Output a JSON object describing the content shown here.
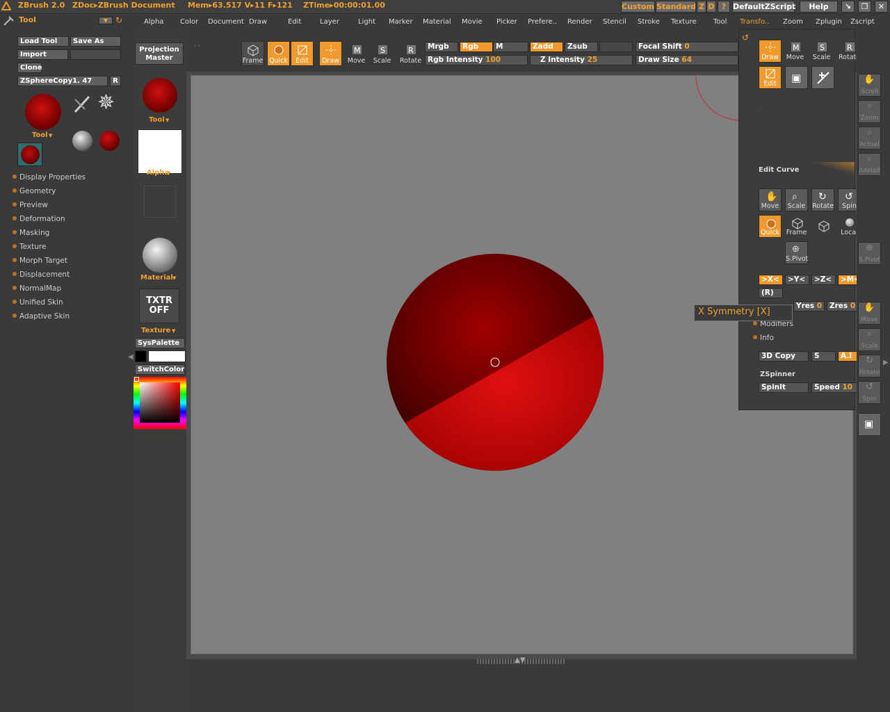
{
  "titlebar": {
    "app": "ZBrush 2.0",
    "doc": "ZDoc▸ZBrush Document",
    "stats": "Mem▸63.517  V▸11  F▸121",
    "ztime": "ZTime▸00:00:01.00",
    "buttons": [
      "Custom",
      "Standard",
      "Z",
      "D",
      "?"
    ],
    "script_button": "DefaultZScript",
    "help_button": "Help"
  },
  "menus": [
    "Alpha",
    "Color",
    "Document",
    "Draw",
    "Edit",
    "Layer",
    "Light",
    "Marker",
    "Material",
    "Movie",
    "Picker",
    "Prefere..",
    "Render",
    "Stencil",
    "Stroke",
    "Texture",
    "Tool",
    "Transfo..",
    "Zoom",
    "Zplugin",
    "Zscript"
  ],
  "tool_palette": {
    "title": "Tool",
    "load_tool": "Load Tool",
    "save_as": "Save As",
    "import": "Import",
    "clone": "Clone",
    "current_tool": "ZSphereCopy1. 47",
    "r_button": "R",
    "tool_label": "Tool",
    "sections": [
      "Display Properties",
      "Geometry",
      "Preview",
      "Deformation",
      "Masking",
      "Texture",
      "Morph Target",
      "Displacement",
      "NormalMap",
      "Unified Skin",
      "Adaptive Skin"
    ]
  },
  "left_shelf": {
    "projection_master": "Projection Master",
    "tool_label": "Tool",
    "alpha_label": "Alpha",
    "material_label": "Material",
    "txtr_off": "TXTR OFF",
    "texture_label": "Texture",
    "syspalette": "SysPalette",
    "switchcolor": "SwitchColor"
  },
  "draw_toolbar": {
    "buttons": [
      {
        "label": "Frame",
        "active": false
      },
      {
        "label": "Quick",
        "active": true
      },
      {
        "label": "Edit",
        "active": true
      },
      {
        "label": "Draw",
        "active": true
      },
      {
        "label": "Move",
        "active": false
      },
      {
        "label": "Scale",
        "active": false
      },
      {
        "label": "Rotate",
        "active": false
      }
    ],
    "mrgb": "Mrgb",
    "rgb": "Rgb",
    "m": "M",
    "zadd": "Zadd",
    "zsub": "Zsub",
    "focal_shift_label": "Focal Shift",
    "focal_shift": "0",
    "rgb_intensity_label": "Rgb Intensity",
    "rgb_intensity": "100",
    "z_intensity_label": "Z Intensity",
    "z_intensity": "25",
    "draw_size_label": "Draw Size",
    "draw_size": "64"
  },
  "transform_panel": {
    "top_buttons": [
      {
        "label": "Draw",
        "active": true
      },
      {
        "label": "Move",
        "active": false
      },
      {
        "label": "Scale",
        "active": false
      },
      {
        "label": "Rotate",
        "active": false
      }
    ],
    "edit_label": "Edit",
    "edit_curve": "Edit Curve",
    "nav_buttons": [
      "Move",
      "Scale",
      "Rotate",
      "Spin"
    ],
    "view_buttons": [
      {
        "label": "Quick",
        "active": true
      },
      {
        "label": "Frame",
        "active": false
      },
      {
        "label": "Local",
        "active": false
      }
    ],
    "spivot": "S.Pivot",
    "sym_buttons": [
      {
        "label": ">X<",
        "active": true
      },
      {
        "label": ">Y<",
        "active": false
      },
      {
        "label": ">Z<",
        "active": false
      },
      {
        "label": ">M<",
        "active": true
      }
    ],
    "r_label": "(R)",
    "yres_label": "Yres",
    "yres": "0",
    "zres_label": "Zres",
    "zres": "0",
    "modifiers": "Modifiers",
    "info": "Info",
    "copy3d": "3D Copy",
    "s_label": "S",
    "ai_label": "A.I",
    "zspinner": "ZSpinner",
    "spinit": "SpinIt",
    "speed_label": "Speed",
    "speed": "10"
  },
  "right_shelf": [
    "Scroll",
    "Zoom",
    "Actual",
    "AAHalf",
    "Move",
    "Scale",
    "Rotate",
    "Spin",
    "Local",
    "S.Pivot"
  ],
  "tooltip": "X Symmetry [X]",
  "colors": {
    "accent": "#f09a2e",
    "sphere": "#b00000",
    "canvas": "#808080"
  }
}
